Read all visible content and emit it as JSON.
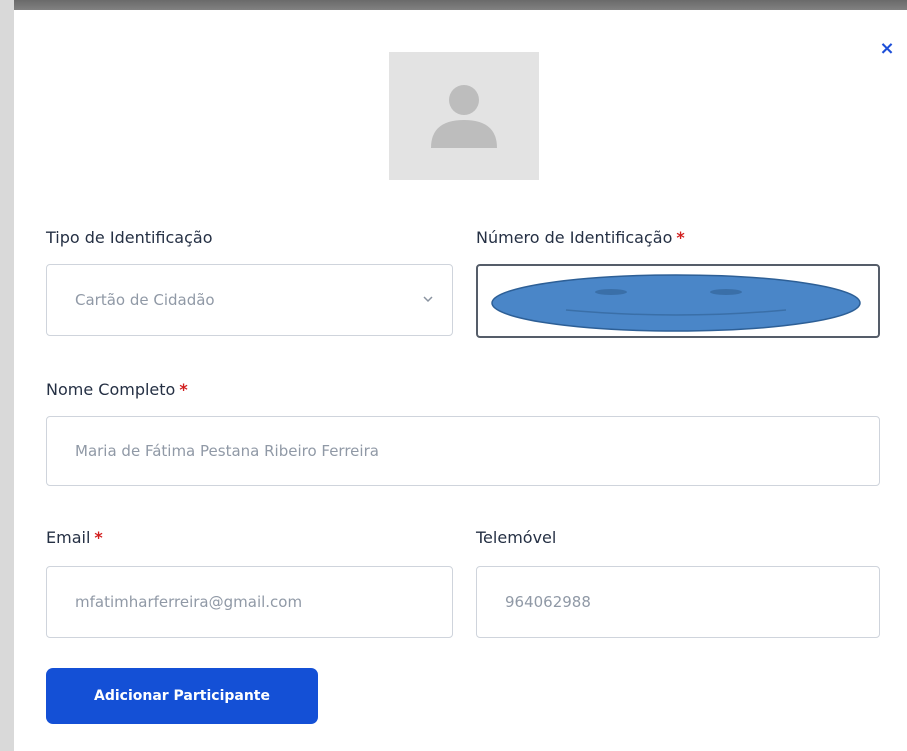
{
  "modal": {
    "close_label": "×",
    "avatar_icon": "user-placeholder-icon"
  },
  "form": {
    "id_type": {
      "label": "Tipo de Identificação",
      "value": "Cartão de Cidadão"
    },
    "id_number": {
      "label": "Número de Identificação",
      "required_mark": "*",
      "value": ""
    },
    "full_name": {
      "label": "Nome Completo",
      "required_mark": "*",
      "value": "Maria de Fátima Pestana Ribeiro Ferreira"
    },
    "email": {
      "label": "Email",
      "required_mark": "*",
      "value": "mfatimharferreira@gmail.com"
    },
    "phone": {
      "label": "Telemóvel",
      "value": "964062988"
    },
    "submit_label": "Adicionar Participante"
  },
  "colors": {
    "primary": "#1450d6",
    "required": "#d21f1f",
    "redaction": "#4a86c8"
  }
}
